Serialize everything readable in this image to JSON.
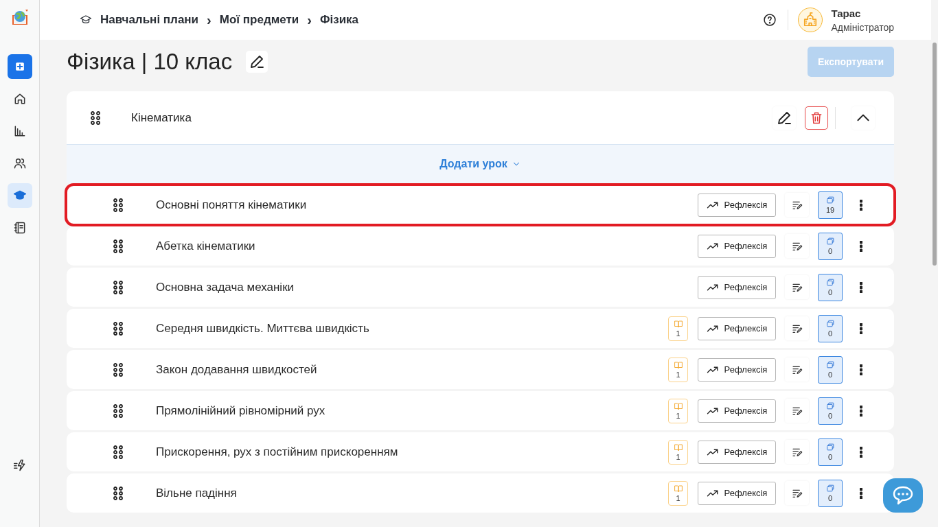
{
  "sidebar": {
    "items": [
      {
        "kind": "add",
        "selected": false
      },
      {
        "kind": "home",
        "selected": false
      },
      {
        "kind": "chart",
        "selected": false
      },
      {
        "kind": "users",
        "selected": false
      },
      {
        "kind": "cap",
        "selected": true
      },
      {
        "kind": "notebook",
        "selected": false
      }
    ]
  },
  "breadcrumbs": [
    "Навчальні плани",
    "Мої предмети",
    "Фізика"
  ],
  "separator": "›",
  "user": {
    "name": "Тарас",
    "role": "Адміністратор"
  },
  "page_title": "Фізика | 10 клас",
  "export_button": {
    "label": "Експортувати",
    "disabled": true
  },
  "module": {
    "title": "Кінематика",
    "expanded": true,
    "add_lesson": "Додати урок"
  },
  "lessons": [
    {
      "title": "Основні поняття кінематики",
      "reflection": "Рефлексія",
      "counter": "19",
      "highlighted": true
    },
    {
      "title": "Абетка кінематики",
      "reflection": "Рефлексія",
      "counter": "0",
      "highlighted": false
    },
    {
      "title": "Основна задача механіки",
      "reflection": "Рефлексія",
      "counter": "0",
      "highlighted": false
    },
    {
      "title": "Середня швидкість. Миттєва швидкість",
      "book": "1",
      "reflection": "Рефлексія",
      "counter": "0",
      "highlighted": false
    },
    {
      "title": "Закон додавання швидкостей",
      "book": "1",
      "reflection": "Рефлексія",
      "counter": "0",
      "highlighted": false
    },
    {
      "title": "Прямолінійний рівномірний рух",
      "book": "1",
      "reflection": "Рефлексія",
      "counter": "0",
      "highlighted": false
    },
    {
      "title": "Прискорення, рух з постійним прискоренням",
      "book": "1",
      "reflection": "Рефлексія",
      "counter": "0",
      "highlighted": false
    },
    {
      "title": "Вільне падіння",
      "book": "1",
      "reflection": "Рефлексія",
      "counter": "0",
      "highlighted": false
    }
  ]
}
